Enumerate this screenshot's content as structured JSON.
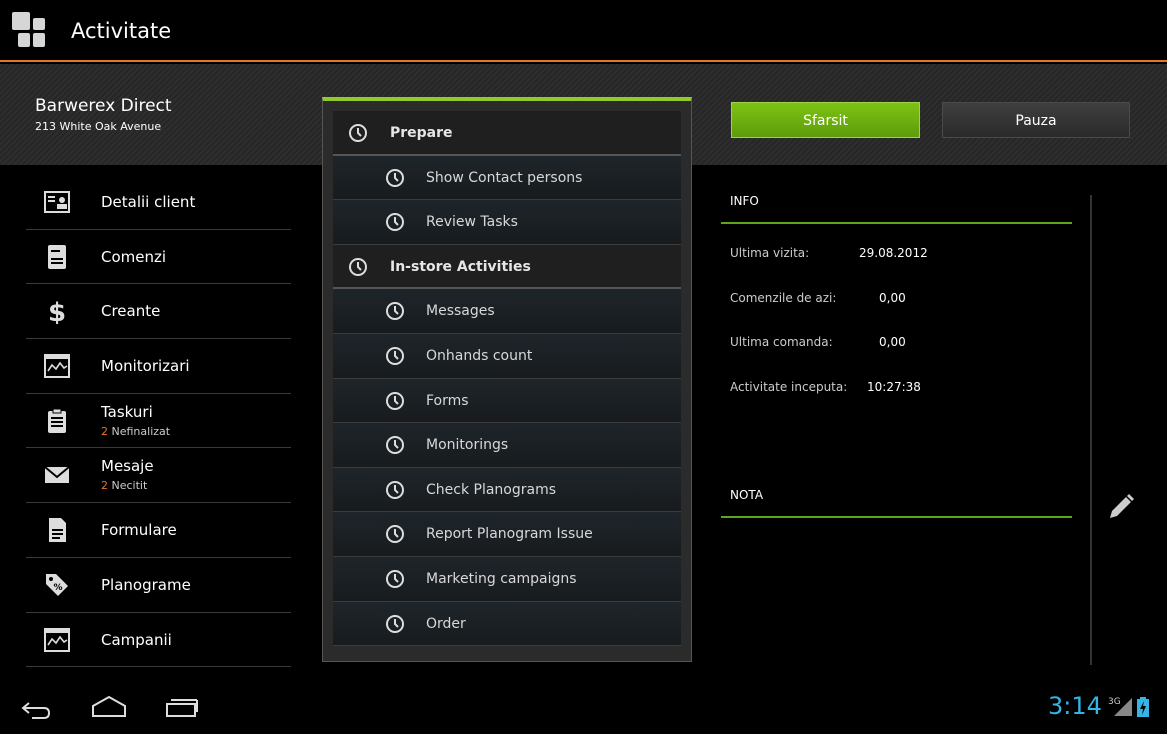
{
  "app": {
    "title": "Activitate",
    "accent": "#e4752c"
  },
  "client": {
    "name": "Barwerex Direct",
    "address": "213 White Oak Avenue"
  },
  "buttons": {
    "end": "Sfarsit",
    "pause": "Pauza"
  },
  "sidebar": {
    "items": [
      {
        "label": "Detalii client",
        "icon": "client-card-icon"
      },
      {
        "label": "Comenzi",
        "icon": "orders-icon"
      },
      {
        "label": "Creante",
        "icon": "dollar-icon"
      },
      {
        "label": "Monitorizari",
        "icon": "monitor-chart-icon"
      },
      {
        "label": "Taskuri",
        "icon": "clipboard-icon",
        "sub_count": "2",
        "sub_text": "Nefinalizat"
      },
      {
        "label": "Mesaje",
        "icon": "mail-icon",
        "sub_count": "2",
        "sub_text": "Necitit"
      },
      {
        "label": "Formulare",
        "icon": "form-document-icon"
      },
      {
        "label": "Planograme",
        "icon": "price-tag-icon"
      },
      {
        "label": "Campanii",
        "icon": "campaign-chart-icon"
      }
    ]
  },
  "activities": {
    "items": [
      {
        "label": "Prepare",
        "type": "group"
      },
      {
        "label": "Show Contact persons",
        "type": "child"
      },
      {
        "label": "Review Tasks",
        "type": "child"
      },
      {
        "label": "In-store Activities",
        "type": "group"
      },
      {
        "label": "Messages",
        "type": "child"
      },
      {
        "label": "Onhands count",
        "type": "child"
      },
      {
        "label": "Forms",
        "type": "child"
      },
      {
        "label": "Monitorings",
        "type": "child"
      },
      {
        "label": "Check Planograms",
        "type": "child"
      },
      {
        "label": "Report Planogram Issue",
        "type": "child"
      },
      {
        "label": "Marketing campaigns",
        "type": "child"
      },
      {
        "label": "Order",
        "type": "child"
      }
    ]
  },
  "info": {
    "title": "INFO",
    "rows": [
      {
        "label": "Ultima vizita:",
        "value": "29.08.2012"
      },
      {
        "label": "Comenzile de azi:",
        "value": "0,00"
      },
      {
        "label": "Ultima comanda:",
        "value": "0,00"
      },
      {
        "label": "Activitate inceputa:",
        "value": "10:27:38"
      }
    ],
    "note_title": "NOTA"
  },
  "statusbar": {
    "time": "3:14",
    "network": "3G"
  }
}
